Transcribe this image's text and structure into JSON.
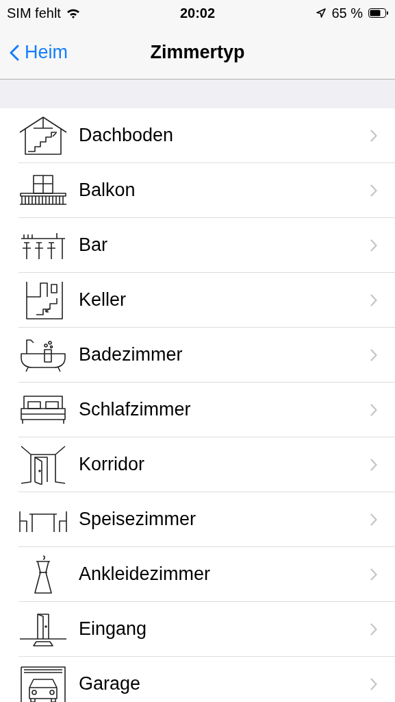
{
  "status_bar": {
    "carrier": "SIM fehlt",
    "time": "20:02",
    "battery": "65 %"
  },
  "nav": {
    "back": "Heim",
    "title": "Zimmertyp"
  },
  "rooms": [
    {
      "label": "Dachboden"
    },
    {
      "label": "Balkon"
    },
    {
      "label": "Bar"
    },
    {
      "label": "Keller"
    },
    {
      "label": "Badezimmer"
    },
    {
      "label": "Schlafzimmer"
    },
    {
      "label": "Korridor"
    },
    {
      "label": "Speisezimmer"
    },
    {
      "label": "Ankleidezimmer"
    },
    {
      "label": "Eingang"
    },
    {
      "label": "Garage"
    }
  ]
}
